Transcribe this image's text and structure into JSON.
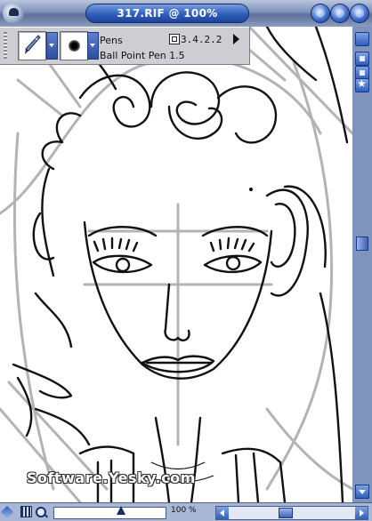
{
  "window": {
    "title": "317.RIF @ 100%"
  },
  "property_bar": {
    "brush_category": "Pens",
    "brush_variant": "Ball Point Pen 1.5",
    "version": "3.4.2.2"
  },
  "canvas": {
    "watermark": "Software.Yesky.com"
  },
  "status_bar": {
    "zoom_label": "100 %",
    "zoom_percent": 100
  },
  "icons": [
    "app-badge-icon",
    "minimize-icon",
    "maximize-icon",
    "close-icon",
    "pen-brush-icon",
    "dab-variant-icon",
    "layer-icon",
    "menu-arrow-icon",
    "drawing-mode-icon",
    "grid-icon",
    "magnifier-icon"
  ],
  "colors": {
    "title_pill": "#2f5fbc",
    "frame": "#6c7ea6",
    "ink": "#111111",
    "guides": "#a8a8a8"
  }
}
